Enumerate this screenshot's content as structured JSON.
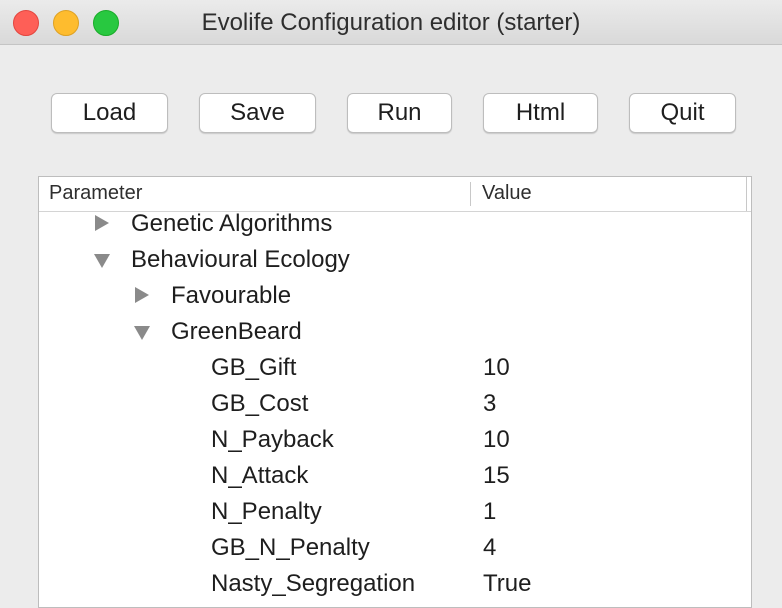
{
  "window": {
    "title": "Evolife Configuration editor (starter)"
  },
  "toolbar": {
    "load_label": "Load",
    "save_label": "Save",
    "run_label": "Run",
    "html_label": "Html",
    "quit_label": "Quit"
  },
  "tree": {
    "columns": {
      "parameter": "Parameter",
      "value": "Value"
    },
    "nodes": [
      {
        "label": "Genetic Algorithms",
        "expanded": false
      },
      {
        "label": "Behavioural Ecology",
        "expanded": true
      },
      {
        "label": "Favourable",
        "expanded": false
      },
      {
        "label": "GreenBeard",
        "expanded": true
      },
      {
        "label": "GB_Gift",
        "value": "10"
      },
      {
        "label": "GB_Cost",
        "value": "3"
      },
      {
        "label": "N_Payback",
        "value": "10"
      },
      {
        "label": "N_Attack",
        "value": "15"
      },
      {
        "label": "N_Penalty",
        "value": "1"
      },
      {
        "label": "GB_N_Penalty",
        "value": "4"
      },
      {
        "label": "Nasty_Segregation",
        "value": "True"
      }
    ]
  },
  "colors": {
    "close": "#fe5f57",
    "minimize": "#febc2e",
    "maximize": "#28c840"
  }
}
